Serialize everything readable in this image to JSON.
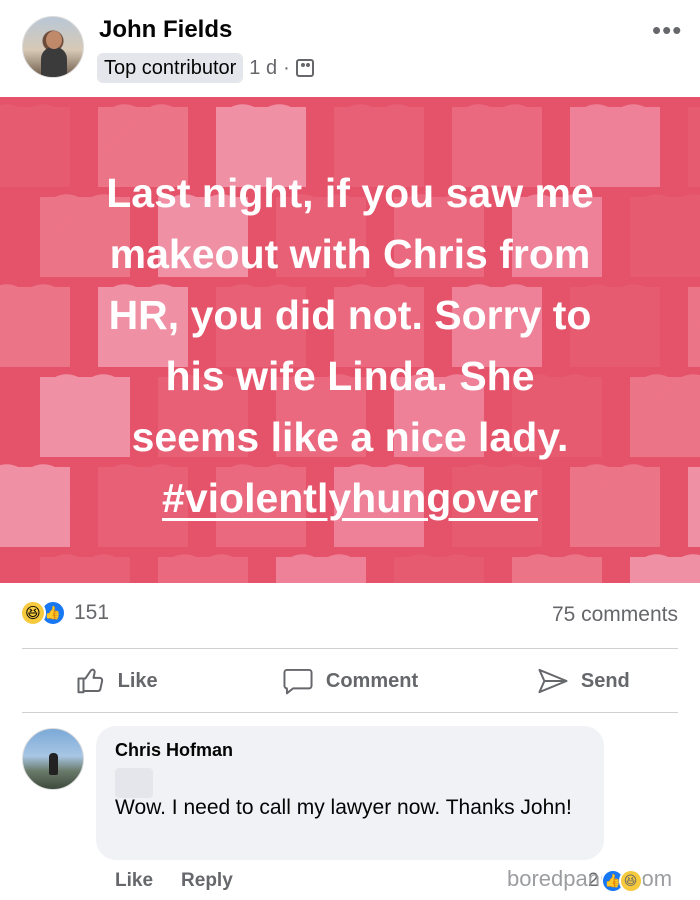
{
  "post": {
    "author": "John Fields",
    "badge": "Top contributor",
    "time": "1 d",
    "separator": "·",
    "more_label": "•••",
    "text_lines": [
      "Last night, if you saw me",
      "makeout with Chris from",
      "HR, you did not. Sorry to",
      "his wife Linda. She",
      "seems like a nice lady."
    ],
    "hashtag": "#violentlyhungover",
    "background_color": "#e4536a"
  },
  "stats": {
    "reaction_count": "151",
    "comments": "75 comments",
    "reaction_icons": [
      "haha-icon",
      "like-icon"
    ]
  },
  "actions": {
    "like": "Like",
    "comment": "Comment",
    "send": "Send"
  },
  "comment": {
    "author": "Chris Hofman",
    "text": "Wow. I need to call my lawyer now. Thanks John!",
    "like": "Like",
    "reply": "Reply",
    "reaction_count": "2"
  },
  "watermark": "boredpanda.com",
  "colors": {
    "accent_blue": "#1877f2",
    "muted_text": "#65676b",
    "bubble": "#f0f2f5"
  }
}
